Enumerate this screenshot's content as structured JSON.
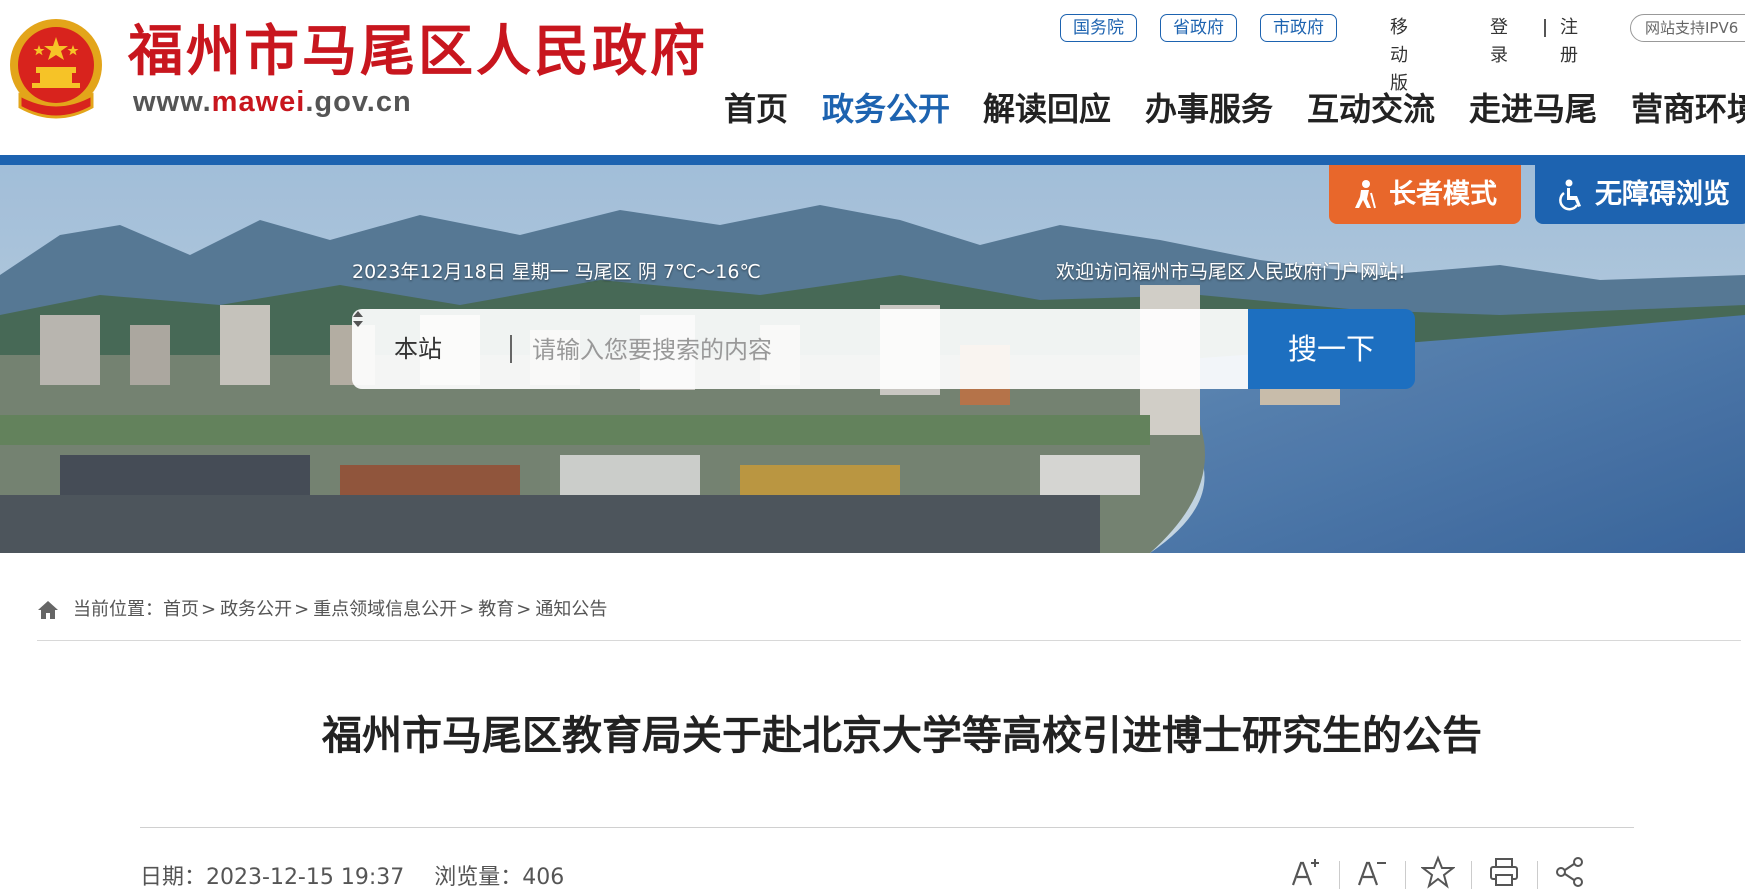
{
  "header": {
    "site_title": "福州市马尾区人民政府",
    "url_prefix": "www.",
    "url_accent": "mawei",
    "url_suffix": ".gov.cn",
    "top_links": {
      "state_council": "国务院",
      "province": "省政府",
      "city": "市政府",
      "mobile": "移动版",
      "login": "登录",
      "register": "注册",
      "ipv6": "网站支持IPV6"
    },
    "nav": [
      "首页",
      "政务公开",
      "解读回应",
      "办事服务",
      "互动交流",
      "走进马尾",
      "营商环境"
    ],
    "nav_active_index": 1
  },
  "banner": {
    "elder_mode": "长者模式",
    "accessible": "无障碍浏览",
    "date_weather": "2023年12月18日 星期一 马尾区 阴 7℃～16℃",
    "welcome": "欢迎访问福州市马尾区人民政府门户网站!",
    "search": {
      "scope": "本站",
      "placeholder": "请输入您要搜索的内容",
      "button": "搜一下"
    }
  },
  "breadcrumb": {
    "prefix": "当前位置：",
    "items": [
      "首页",
      "政务公开",
      "重点领域信息公开",
      "教育",
      "通知公告"
    ]
  },
  "article": {
    "title": "福州市马尾区教育局关于赴北京大学等高校引进博士研究生的公告",
    "date_label": "日期：",
    "date": "2023-12-15 19:37",
    "views_label": "浏览量：",
    "views": "406"
  },
  "icons": {
    "font_increase": "font-increase-icon",
    "font_decrease": "font-decrease-icon",
    "favorite": "star-icon",
    "print": "print-icon",
    "share": "share-icon"
  },
  "colors": {
    "brand_red": "#c8161e",
    "brand_blue": "#1d63b0",
    "elder_orange": "#e8672b"
  }
}
